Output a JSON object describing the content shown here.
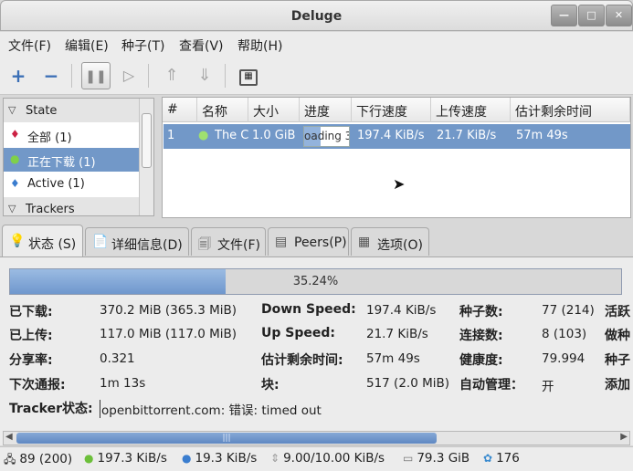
{
  "window": {
    "title": "Deluge"
  },
  "menu": [
    "文件(F)",
    "编辑(E)",
    "种子(T)",
    "查看(V)",
    "帮助(H)"
  ],
  "sidebar": {
    "state_header": "State",
    "items": [
      {
        "label": "全部 (1)",
        "icon": "all-icon"
      },
      {
        "label": "正在下载 (1)",
        "icon": "downloading-icon",
        "selected": true
      },
      {
        "label": "Active (1)",
        "icon": "active-icon"
      }
    ],
    "trackers_header": "Trackers"
  },
  "table": {
    "columns": [
      "#",
      "名称",
      "大小",
      "进度",
      "下行速度",
      "上传速度",
      "估计剩余时间"
    ],
    "rows": [
      {
        "num": "1",
        "name": "The C",
        "size": "1.0 GiB",
        "progress_text": "oading 3",
        "progress": 0.3524,
        "down": "197.4 KiB/s",
        "up": "21.7 KiB/s",
        "eta": "57m 49s"
      }
    ]
  },
  "tabs": [
    "状态 (S)",
    "详细信息(D)",
    "文件(F)",
    "Peers(P)",
    "选项(O)"
  ],
  "status": {
    "progress_text": "35.24%",
    "progress": 0.3524,
    "downloaded_label": "已下载:",
    "downloaded": "370.2 MiB (365.3 MiB)",
    "uploaded_label": "已上传:",
    "uploaded": "117.0 MiB (117.0 MiB)",
    "ratio_label": "分享率:",
    "ratio": "0.321",
    "next_announce_label": "下次通报:",
    "next_announce": "1m 13s",
    "tracker_label": "Tracker状态:",
    "tracker": "openbittorrent.com: 错误: timed out",
    "down_speed_label": "Down Speed:",
    "down_speed": "197.4 KiB/s",
    "up_speed_label": "Up Speed:",
    "up_speed": "21.7 KiB/s",
    "eta_label": "估计剩余时间:",
    "eta": "57m 49s",
    "pieces_label": "块:",
    "pieces": "517 (2.0 MiB)",
    "seeds_label": "种子数:",
    "seeds": "77 (214)",
    "peers_label": "连接数:",
    "peers": "8 (103)",
    "availability_label": "健康度:",
    "availability": "79.994",
    "auto_managed_label": "自动管理：",
    "auto_managed": "开",
    "col4": [
      "活跃",
      "做种",
      "种子",
      "添加"
    ]
  },
  "statusbar": {
    "connections": "89 (200)",
    "down": "197.3 KiB/s",
    "up": "19.3 KiB/s",
    "protocol": "9.00/10.00 KiB/s",
    "disk": "79.3 GiB",
    "dht": "176"
  }
}
